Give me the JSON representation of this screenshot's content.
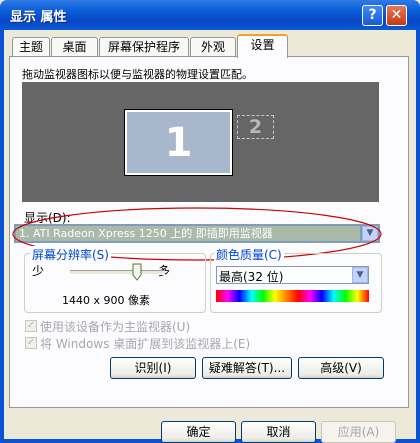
{
  "window": {
    "title": "显示 属性",
    "help_glyph": "?",
    "close_glyph": "✕"
  },
  "tabs": [
    {
      "label": "主题"
    },
    {
      "label": "桌面"
    },
    {
      "label": "屏幕保护程序"
    },
    {
      "label": "外观"
    },
    {
      "label": "设置",
      "active": true
    }
  ],
  "settings": {
    "instruction": "拖动监视器图标以便与监视器的物理设置匹配。",
    "monitors": [
      {
        "number": "1"
      },
      {
        "number": "2"
      }
    ],
    "display_label": "显示(D):",
    "display_value": "1. ATI Radeon Xpress 1250 上的 即插即用监视器",
    "resolution": {
      "group_label": "屏幕分辨率(S)",
      "less_label": "少",
      "more_label": "多",
      "value_text": "1440 x 900 像素"
    },
    "color_quality": {
      "group_label": "颜色质量(C)",
      "selected": "最高(32 位)"
    },
    "checkboxes": [
      {
        "label": "使用该设备作为主监视器(U)",
        "checked": true
      },
      {
        "label": "将 Windows 桌面扩展到该监视器上(E)",
        "checked": true
      }
    ],
    "buttons": {
      "identify": "识别(I)",
      "troubleshoot": "疑难解答(T)...",
      "advanced": "高级(V)"
    }
  },
  "footer": {
    "ok": "确定",
    "cancel": "取消",
    "apply": "应用(A)"
  },
  "colors": {
    "title_bar": "#0a52d4",
    "dialog_bg": "#ece9d8",
    "annotation_ellipse": "#cc0000"
  }
}
